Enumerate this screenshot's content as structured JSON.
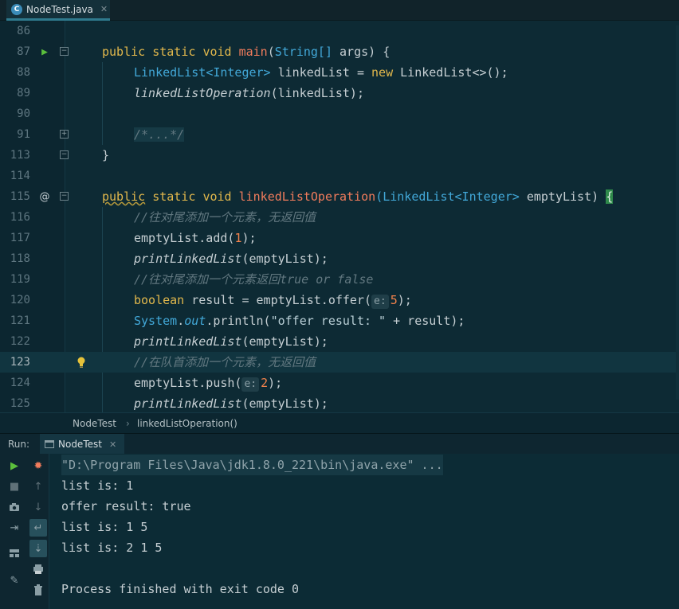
{
  "tab": {
    "label": "NodeTest.java",
    "icon": "java-class-icon"
  },
  "editor": {
    "lines": [
      {
        "num": "86"
      },
      {
        "num": "87"
      },
      {
        "num": "88"
      },
      {
        "num": "89"
      },
      {
        "num": "90"
      },
      {
        "num": "91"
      },
      {
        "num": "113"
      },
      {
        "num": "114"
      },
      {
        "num": "115"
      },
      {
        "num": "116"
      },
      {
        "num": "117"
      },
      {
        "num": "118"
      },
      {
        "num": "119"
      },
      {
        "num": "120"
      },
      {
        "num": "121"
      },
      {
        "num": "122"
      },
      {
        "num": "123"
      },
      {
        "num": "124"
      },
      {
        "num": "125"
      }
    ],
    "tokens": {
      "public": "public",
      "static": "static",
      "void": "void",
      "main": "main",
      "string_arr": "String[]",
      "args_open": " args) {",
      "open_paren": "(",
      "linkedlist": "LinkedList",
      "integer_generic": "<Integer>",
      "linkedlist_decl": " linkedList = ",
      "new_kw": "new",
      "linkedlist_new": " LinkedList<>();",
      "call_op": "linkedListOperation",
      "call_arg": "(linkedList);",
      "folded": "/*...*/",
      "close_brace": "}",
      "method_name": "linkedListOperation",
      "param_type_open": "(LinkedList",
      "param_generic": "<Integer>",
      "param_name": " emptyList) ",
      "open_brace": "{",
      "comment1": "//往对尾添加一个元素，无返回值",
      "add_call": "emptyList.add(",
      "one": "1",
      "close_stmt": ");",
      "print_fn": "printLinkedList",
      "print_arg": "(emptyList);",
      "comment2": "//往对尾添加一个元素返回true or false",
      "boolean_kw": "boolean",
      "offer_decl": " result = emptyList.offer(",
      "hint_e": "e:",
      "five": "5",
      "system": "System",
      "dot": ".",
      "out": "out",
      "println": ".println(",
      "offer_str": "\"offer result: \"",
      "plus_result": " + result);",
      "comment3": "//在队首添加一个元素，无返回值",
      "push_call": "emptyList.push(",
      "two": "2"
    }
  },
  "breadcrumb": {
    "items": [
      "NodeTest",
      "linkedListOperation()"
    ],
    "separator": "›"
  },
  "run": {
    "label": "Run:",
    "tab_label": "NodeTest",
    "console": [
      "\"D:\\Program Files\\Java\\jdk1.8.0_221\\bin\\java.exe\" ...",
      "list is: 1",
      "offer result: true",
      "list is: 1 5",
      "list is: 2 1 5",
      "",
      "Process finished with exit code 0"
    ]
  },
  "colors": {
    "background": "#0d2a34",
    "keyword": "#e2b84c",
    "type": "#42a8d8",
    "method": "#f27c5c",
    "comment": "#627880",
    "number": "#f2824c"
  }
}
